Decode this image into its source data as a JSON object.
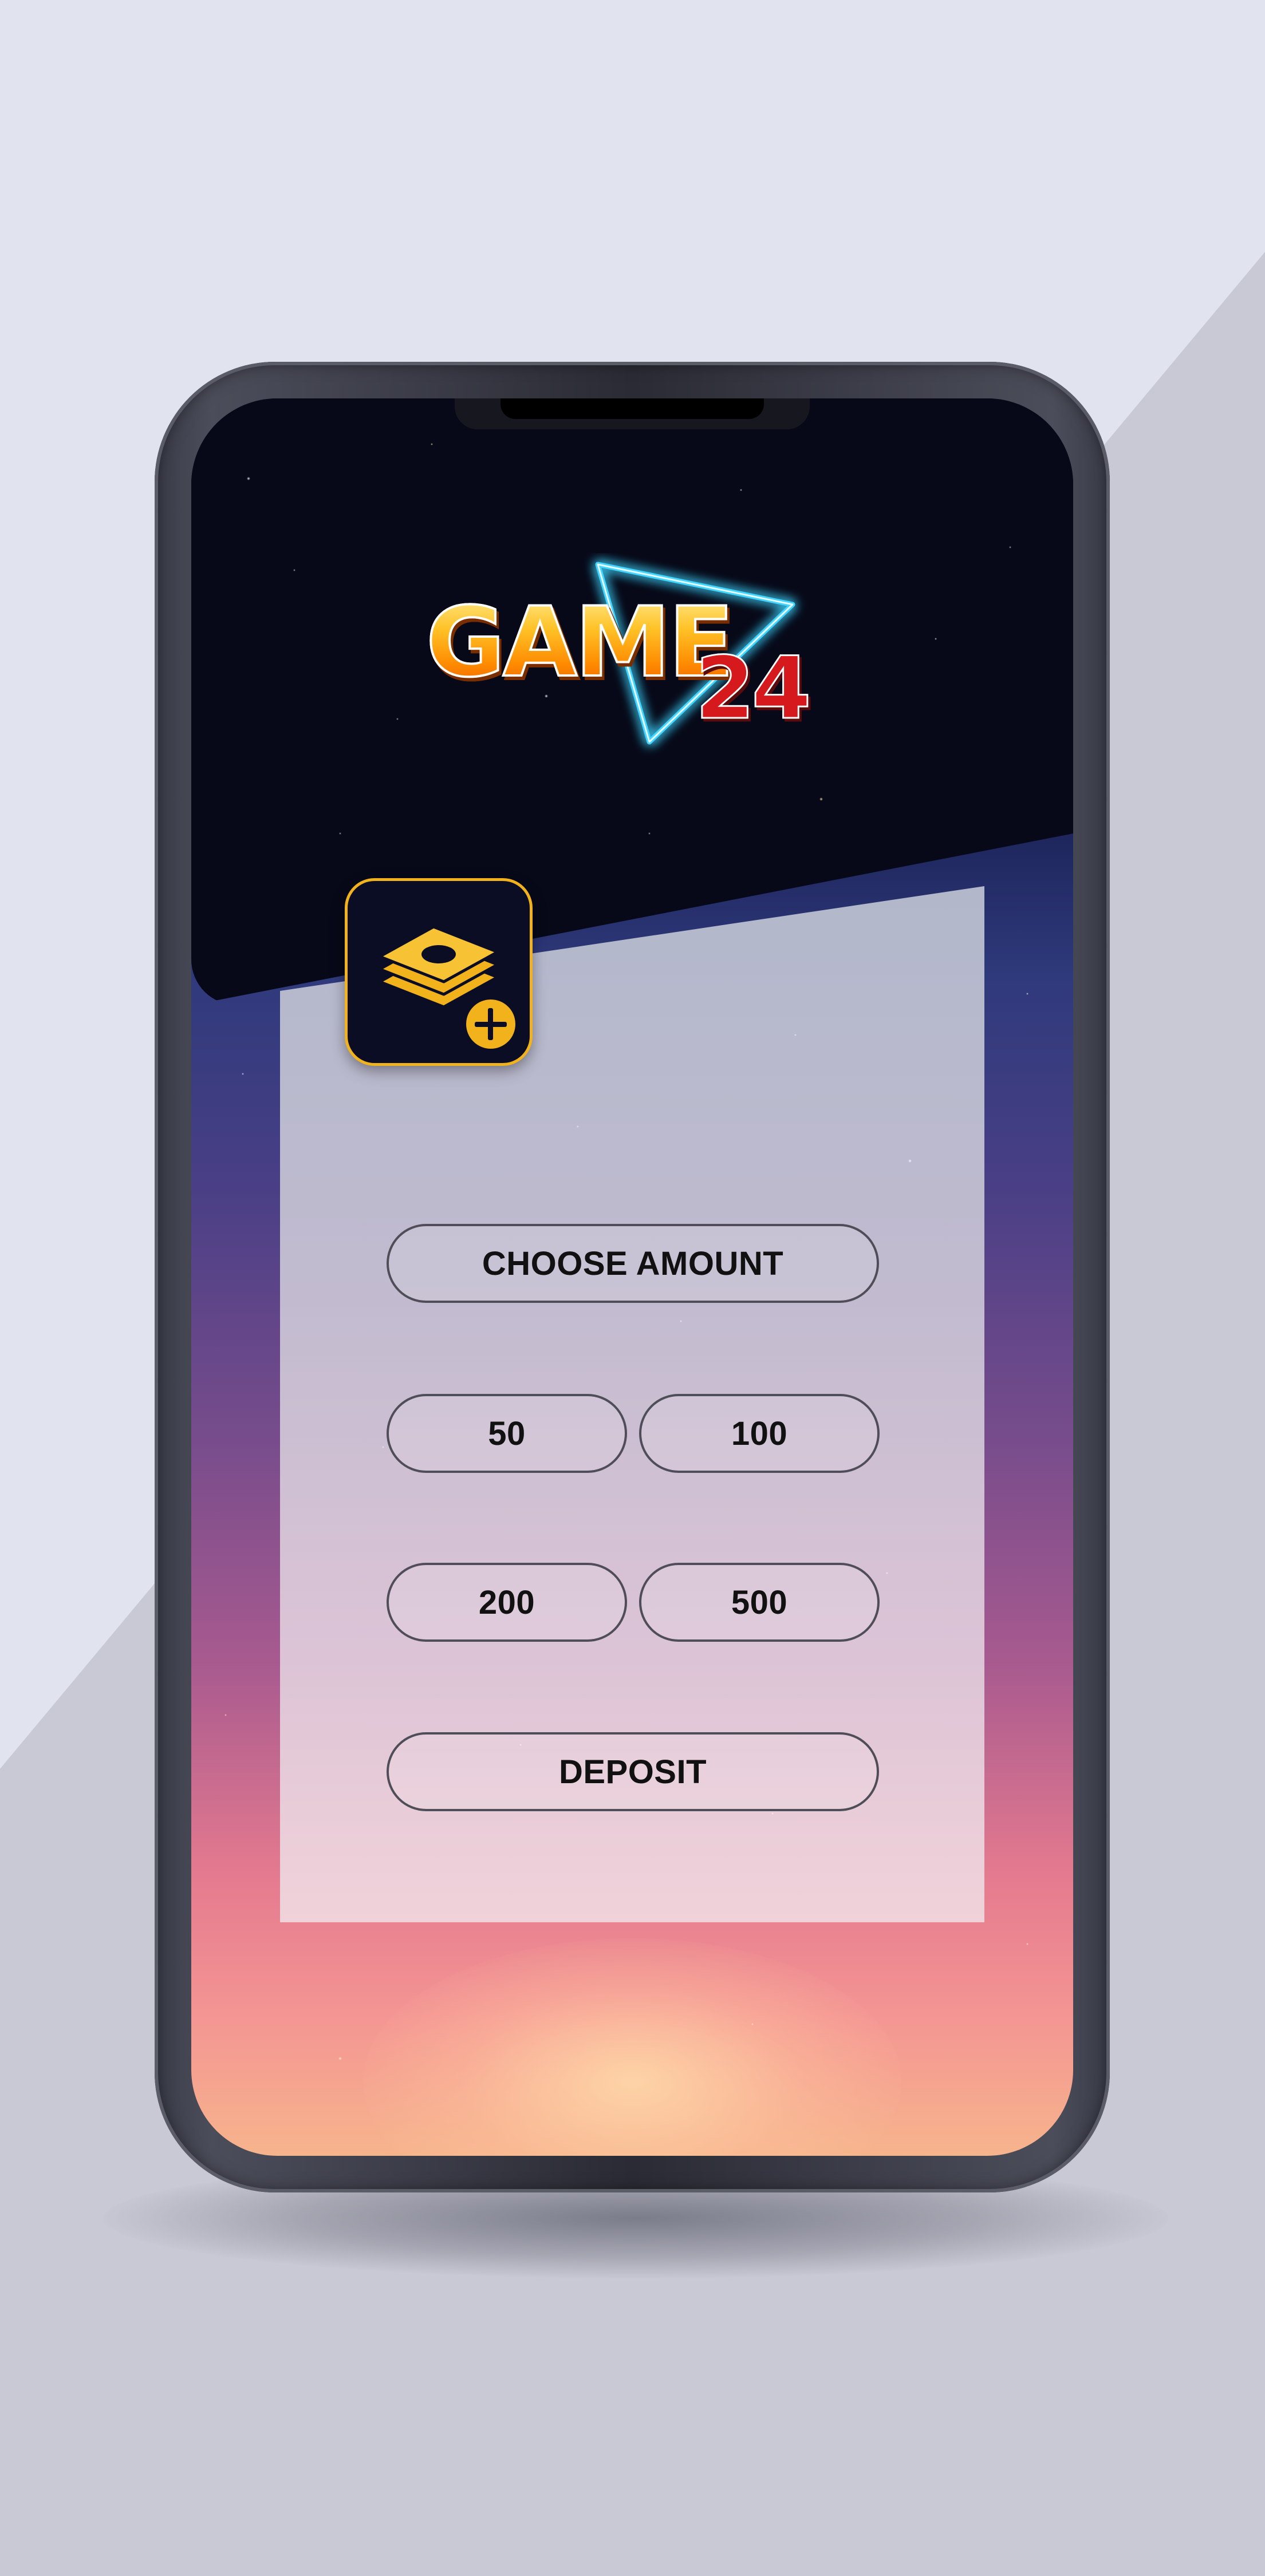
{
  "logo": {
    "word": "GAME",
    "number": "24"
  },
  "deposit_card": {
    "choose_amount_label": "CHOOSE AMOUNT",
    "amounts": [
      "50",
      "100",
      "200",
      "500"
    ],
    "deposit_label": "DEPOSIT"
  },
  "colors": {
    "accent_gold": "#f2b21c",
    "icon_background": "#0b0d24",
    "logo_orange": "#ff9a0a",
    "logo_red": "#d5191c",
    "neon_cyan": "#3fd6ff",
    "button_border": "#4e4d58"
  },
  "icons": {
    "deposit": "stacked-money-plus-icon",
    "logo_shape": "neon-triangle"
  }
}
